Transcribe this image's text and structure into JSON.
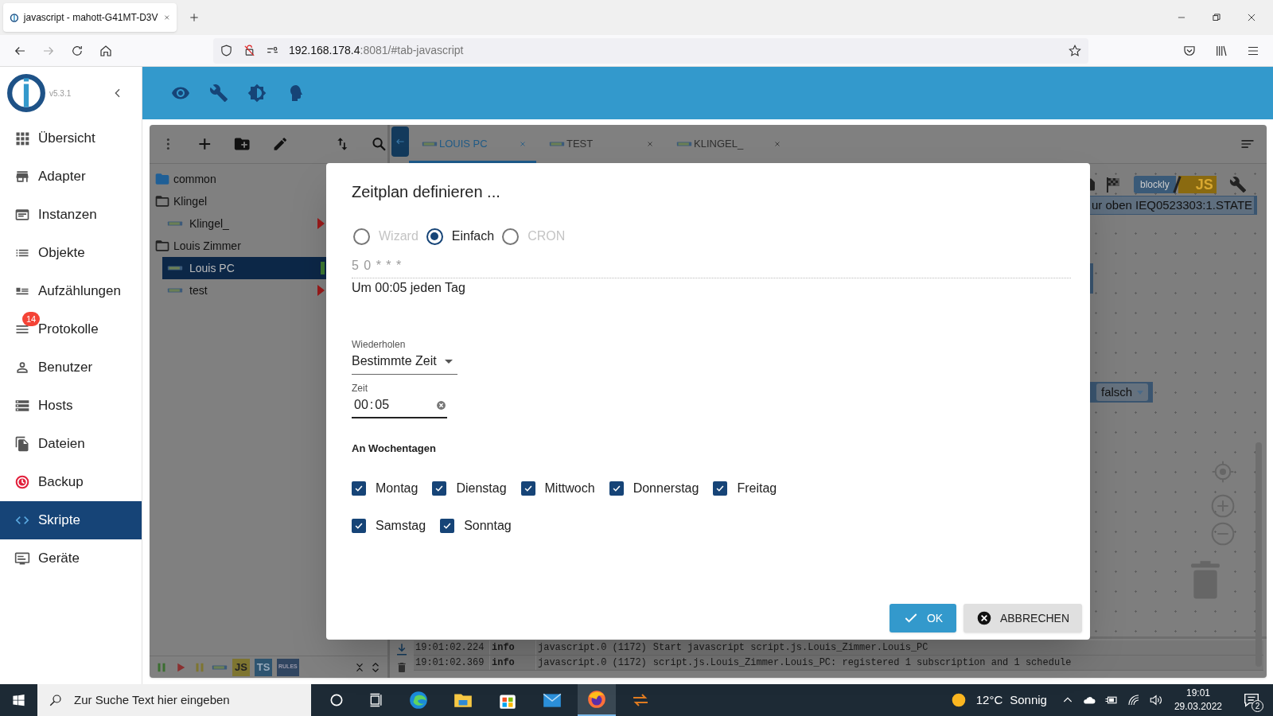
{
  "browser": {
    "tab_title": "javascript - mahott-G41MT-D3V",
    "url_host": "192.168.178.4",
    "url_rest": ":8081/#tab-javascript"
  },
  "app": {
    "version": "v5.3.1"
  },
  "sidebar": {
    "items": [
      {
        "label": "Übersicht",
        "selected": false
      },
      {
        "label": "Adapter",
        "selected": false
      },
      {
        "label": "Instanzen",
        "selected": false
      },
      {
        "label": "Objekte",
        "selected": false
      },
      {
        "label": "Aufzählungen",
        "selected": false
      },
      {
        "label": "Protokolle",
        "selected": false,
        "badge": "14"
      },
      {
        "label": "Benutzer",
        "selected": false
      },
      {
        "label": "Hosts",
        "selected": false
      },
      {
        "label": "Dateien",
        "selected": false
      },
      {
        "label": "Backup",
        "selected": false
      },
      {
        "label": "Skripte",
        "selected": true
      },
      {
        "label": "Geräte",
        "selected": false
      }
    ]
  },
  "script_tree": [
    {
      "label": "common",
      "kind": "folder",
      "expanded": false
    },
    {
      "label": "Klingel",
      "kind": "folder",
      "expanded": true,
      "children": [
        {
          "label": "Klingel_",
          "kind": "script",
          "selected": false,
          "running": false
        }
      ]
    },
    {
      "label": "Louis Zimmer",
      "kind": "folder",
      "expanded": true,
      "children": [
        {
          "label": "Louis PC",
          "kind": "script",
          "selected": true,
          "running": true
        },
        {
          "label": "test",
          "kind": "script",
          "selected": false,
          "running": false
        }
      ]
    }
  ],
  "editor_tabs": [
    {
      "label": "LOUIS PC",
      "selected": true
    },
    {
      "label": "TEST",
      "selected": false
    },
    {
      "label": "KLINGEL_",
      "selected": false
    }
  ],
  "canvas": {
    "block_text": "ur oben IEQ0523303:1.STATE",
    "dropdown_value": "falsch",
    "mode_left": "blockly",
    "mode_right": "JS"
  },
  "bottom_toolbar": {
    "badges": [
      "JS",
      "TS",
      "RULES"
    ]
  },
  "log": [
    {
      "time": "19:01:02.224",
      "level": "info",
      "source": "javascript.0 (1172)",
      "message": "Start javascript script.js.Louis_Zimmer.Louis_PC"
    },
    {
      "time": "19:01:02.369",
      "level": "info",
      "source": "javascript.0 (1172)",
      "message": "script.js.Louis_Zimmer.Louis_PC: registered 1 subscription and 1 schedule"
    }
  ],
  "dialog": {
    "title": "Zeitplan definieren ...",
    "modes": [
      {
        "label": "Wizard",
        "selected": false
      },
      {
        "label": "Einfach",
        "selected": true
      },
      {
        "label": "CRON",
        "selected": false
      }
    ],
    "cron": "5 0 * * *",
    "description": "Um 00:05 jeden Tag",
    "repeat": {
      "label": "Wiederholen",
      "value": "Bestimmte Zeit"
    },
    "time": {
      "label": "Zeit",
      "hours": "00",
      "separator": ":",
      "minutes": "05"
    },
    "weekdays_heading": "An Wochentagen",
    "weekdays": [
      {
        "label": "Montag",
        "checked": true
      },
      {
        "label": "Dienstag",
        "checked": true
      },
      {
        "label": "Mittwoch",
        "checked": true
      },
      {
        "label": "Donnerstag",
        "checked": true
      },
      {
        "label": "Freitag",
        "checked": true
      },
      {
        "label": "Samstag",
        "checked": true
      },
      {
        "label": "Sonntag",
        "checked": true
      }
    ],
    "ok": "OK",
    "cancel": "ABBRECHEN"
  },
  "taskbar": {
    "search_placeholder": "Zur Suche Text hier eingeben",
    "temperature": "12°C",
    "weather": "Sonnig",
    "time": "19:01",
    "date": "29.03.2022",
    "notifications": "2"
  }
}
